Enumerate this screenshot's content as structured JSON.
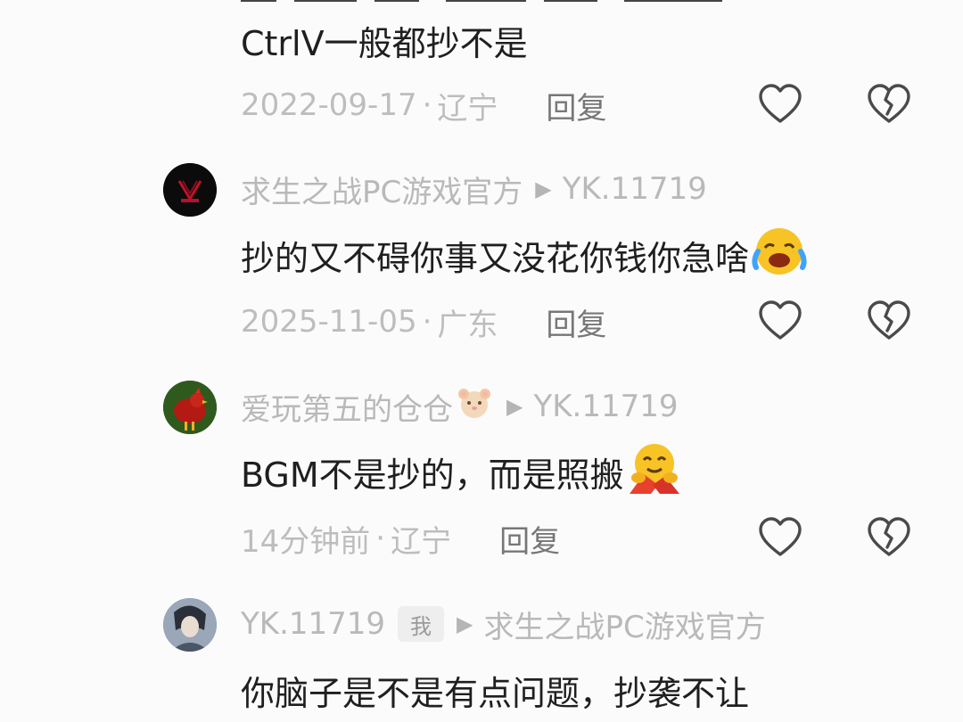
{
  "prev_comment": {
    "text": "CtrlV一般都抄不是",
    "time": "2022-09-17",
    "location": "辽宁",
    "reply_label": "回复"
  },
  "comments": [
    {
      "author": "求生之战PC游戏官方",
      "reply_to": "YK.11719",
      "text": "抄的又不碍你事又没花你钱你急啥",
      "emoji": "loudly-crying-laughing-emoji",
      "time": "2025-11-05",
      "location": "广东",
      "reply_label": "回复"
    },
    {
      "author": "爱玩第五的仓仓",
      "author_emoji": "hamster-emoji",
      "reply_to": "YK.11719",
      "text": "BGM不是抄的，而是照搬",
      "emoji": "hugging-face-emoji",
      "time": "14分钟前",
      "location": "辽宁",
      "reply_label": "回复"
    },
    {
      "author": "YK.11719",
      "badge": "我",
      "reply_to": "求生之战PC游戏官方",
      "text": "你脑子是不是有点问题，抄袭不让"
    }
  ],
  "separator": "·",
  "colors": {
    "background": "#fbfbfb",
    "meta_text": "#b9b9b9",
    "body_text": "#1f1f1f",
    "reply_text": "#777777",
    "icon_stroke": "#4a4a4a"
  }
}
